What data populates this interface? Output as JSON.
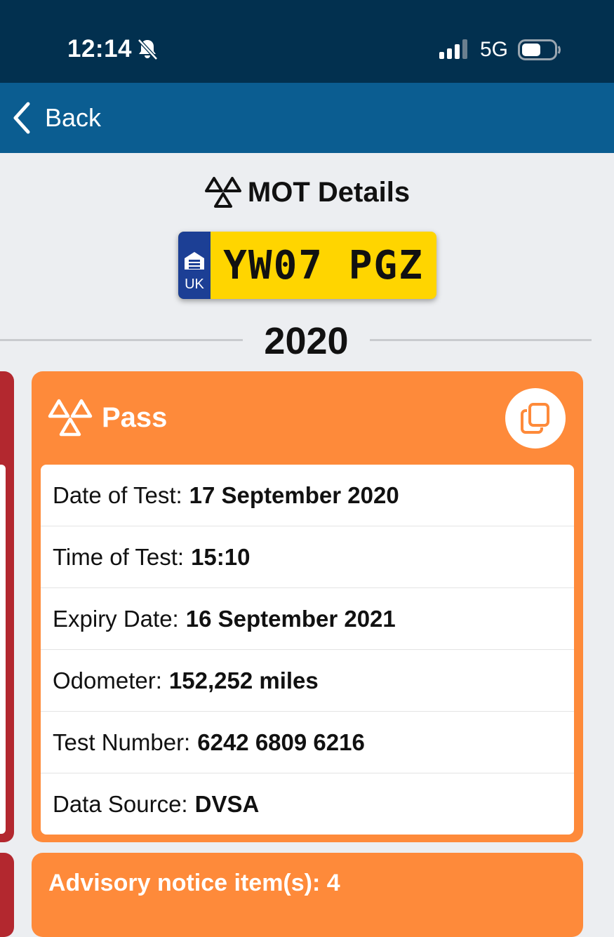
{
  "status_bar": {
    "time": "12:14",
    "network": "5G",
    "icons": [
      "bell-slash-icon",
      "signal-icon",
      "battery-icon"
    ]
  },
  "nav": {
    "back_label": "Back",
    "icon": "chevron-left-icon"
  },
  "header": {
    "title": "MOT Details",
    "icon": "mot-triangles-icon"
  },
  "plate": {
    "country": "UK",
    "number": "YW07 PGZ",
    "colors": {
      "plate": "#ffd500",
      "band": "#1c3f95"
    }
  },
  "year": "2020",
  "card": {
    "result": "Pass",
    "icon": "mot-triangles-icon",
    "copy_icon": "copy-icon",
    "details": [
      {
        "label": "Date of Test:",
        "value": "17 September 2020"
      },
      {
        "label": "Time of Test:",
        "value": "15:10"
      },
      {
        "label": "Expiry Date:",
        "value": "16 September 2021"
      },
      {
        "label": "Odometer:",
        "value": "152,252 miles"
      },
      {
        "label": "Test Number:",
        "value": "6242 6809 6216"
      },
      {
        "label": "Data Source:",
        "value": "DVSA"
      }
    ],
    "colors": {
      "accent": "#fe8a3a",
      "fail_card": "#b3282f"
    }
  },
  "advisory": {
    "label": "Advisory notice item(s): 4"
  },
  "colors": {
    "status_bar": "#02304f",
    "nav_bar": "#0b5d91",
    "background": "#eceef1"
  }
}
